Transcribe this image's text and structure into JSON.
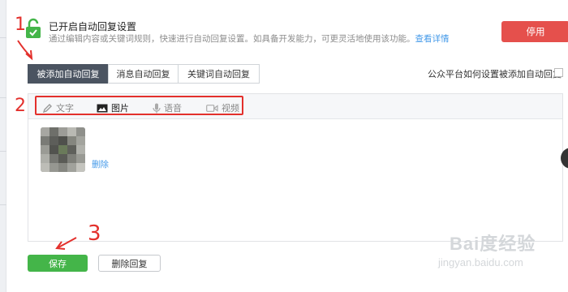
{
  "notice": {
    "title": "已开启自动回复设置",
    "description": "通过编辑内容或关键词规则，快速进行自动回复设置。如具备开发能力，可更灵活地使用该功能。",
    "link": "查看详情",
    "disable_label": "停用"
  },
  "tabs": [
    {
      "label": "被添加自动回复",
      "active": true
    },
    {
      "label": "消息自动回复",
      "active": false
    },
    {
      "label": "关键词自动回复",
      "active": false
    }
  ],
  "help_link": "公众平台如何设置被添加自动回复",
  "toolbar": {
    "text_label": "文字",
    "image_label": "图片",
    "voice_label": "语音",
    "video_label": "视频"
  },
  "content": {
    "delete_label": "删除"
  },
  "actions": {
    "save_label": "保存",
    "delete_reply_label": "删除回复"
  },
  "annotations": {
    "step1": "1",
    "step2": "2",
    "step3": "3"
  },
  "watermark": {
    "brand": "Bai度经验",
    "url": "jingyan.baidu.com"
  },
  "colors": {
    "accent_green": "#44b549",
    "danger_red": "#e5504c",
    "tab_active": "#4b5461",
    "link_blue": "#459ae9",
    "annotation_red": "#e3302c"
  }
}
